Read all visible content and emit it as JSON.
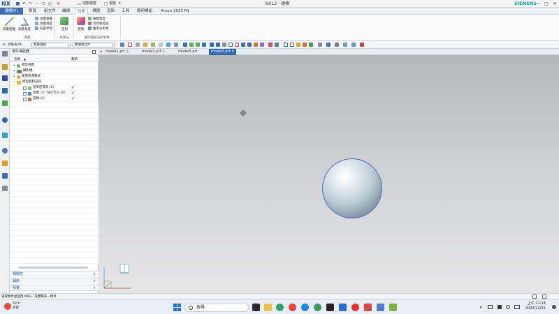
{
  "app": {
    "logo": "NX",
    "window_title": "NX12 - 建模",
    "brand": "SIEMENS",
    "window_controls": [
      "—",
      "□",
      "✕"
    ]
  },
  "ribbon_tabs": [
    {
      "label": "檔案(F)",
      "state": "file"
    },
    {
      "label": "首頁",
      "state": ""
    },
    {
      "label": "組立件",
      "state": ""
    },
    {
      "label": "曲線",
      "state": ""
    },
    {
      "label": "分析",
      "state": "active"
    },
    {
      "label": "視圖",
      "state": ""
    },
    {
      "label": "渲染",
      "state": ""
    },
    {
      "label": "工具",
      "state": ""
    },
    {
      "label": "應用模組",
      "state": ""
    },
    {
      "label": "Ansys 2023 R1",
      "state": ""
    }
  ],
  "quick_access": {
    "touch_mode_label": "切換視窗",
    "window_label": "視窗",
    "window_arrow": "▾"
  },
  "ribbon": {
    "groups": [
      {
        "label": "測量",
        "items": [
          "測量距離",
          "測量角度"
        ],
        "small_items": [
          "測量距離",
          "測量角度",
          "局部半徑"
        ]
      },
      {
        "label": "形狀分",
        "items": [
          "反射"
        ],
        "small_items": []
      },
      {
        "label": "顯示圖形分析物件",
        "items": [
          "選項"
        ],
        "small_items": [
          "拔模角度",
          "可見性錯誤",
          "曲率分析梳"
        ]
      }
    ]
  },
  "command_bar": {
    "menu_label": "功能表(M)",
    "filter_value": "無篩選器",
    "scope_value": "整個組立件"
  },
  "navigator": {
    "title": "零件導航器",
    "col_name": "名稱",
    "col_sort": "▲",
    "col_latest": "最新",
    "rows": [
      {
        "expand": "+",
        "text": "模型視圖",
        "indent": 0,
        "check": false,
        "ok": false
      },
      {
        "expand": "+",
        "text": "攝影機",
        "indent": 0,
        "check": false,
        "ok": false
      },
      {
        "expand": "+",
        "text": "使用者運算式",
        "indent": 0,
        "check": false,
        "ok": false
      },
      {
        "expand": "−",
        "text": "模型歷程記錄",
        "indent": 0,
        "check": false,
        "ok": false
      },
      {
        "expand": "",
        "text": "基準座標系 (0)",
        "indent": 1,
        "check": true,
        "ok": true
      },
      {
        "expand": "",
        "text": "草圖 (1) \"SKETCH_00...",
        "indent": 1,
        "check": true,
        "ok": true
      },
      {
        "expand": "",
        "text": "旋轉 (2)",
        "indent": 1,
        "check": true,
        "ok": true
      }
    ],
    "ok_mark": "✔",
    "panels": [
      "相關性",
      "細節",
      "預覽"
    ]
  },
  "document_tabs": [
    {
      "label": "model1.prt ⓘ",
      "active": false
    },
    {
      "label": "model2.prt ⓘ",
      "active": false
    },
    {
      "label": "model5.prt",
      "active": false
    },
    {
      "label": "model3.prt ✕",
      "active": true
    }
  ],
  "status": {
    "text": "選取物件並使用 MB3，或雙擊某一物件"
  },
  "taskbar": {
    "weather_temp": "19°C",
    "weather_desc": "多雲",
    "search_placeholder": "搜尋",
    "time": "上午 11:18",
    "date": "2023/12/31"
  },
  "colors": {
    "accent": "#2f6ab0",
    "sphere_edge": "#4f6ad0",
    "check_green": "#1f9a2e",
    "siemens": "#0a9b9b"
  }
}
